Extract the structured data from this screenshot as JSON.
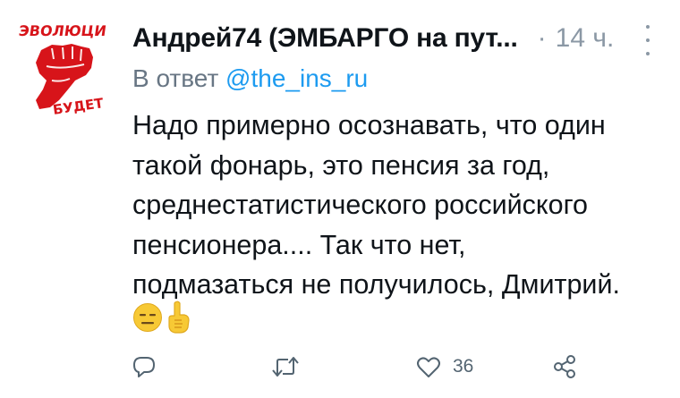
{
  "tweet": {
    "author": {
      "display_name": "Андрей74 (ЭМБАРГО на пут...",
      "avatar": {
        "icon": "raised-fist-poster-icon",
        "text_top": "ЭВОЛЮЦИ",
        "text_bottom": "БУДЕТ",
        "color": "#d7141a"
      }
    },
    "separator": "·",
    "time": "14 ч.",
    "more_icon": "vertical-dots-icon",
    "reply_to": {
      "prefix": "В ответ",
      "mention": "@the_ins_ru"
    },
    "text_lines": [
      "Надо примерно осознавать, что один",
      "такой фонарь, это  пенсия за год,",
      "среднестатистического российского",
      "пенсионера.... Так что нет,",
      "подмазаться не получилось, Дмитрий."
    ],
    "emojis": [
      "expressionless-face-icon",
      "pointing-up-hand-icon"
    ],
    "actions": {
      "reply": {
        "icon": "reply-icon",
        "count": ""
      },
      "retweet": {
        "icon": "retweet-icon",
        "count": ""
      },
      "like": {
        "icon": "heart-icon",
        "count": "36"
      },
      "share": {
        "icon": "share-icon",
        "count": ""
      }
    },
    "colors": {
      "text": "#0f1419",
      "secondary": "#536471",
      "link": "#1d9bf0",
      "icon": "#536471"
    }
  }
}
